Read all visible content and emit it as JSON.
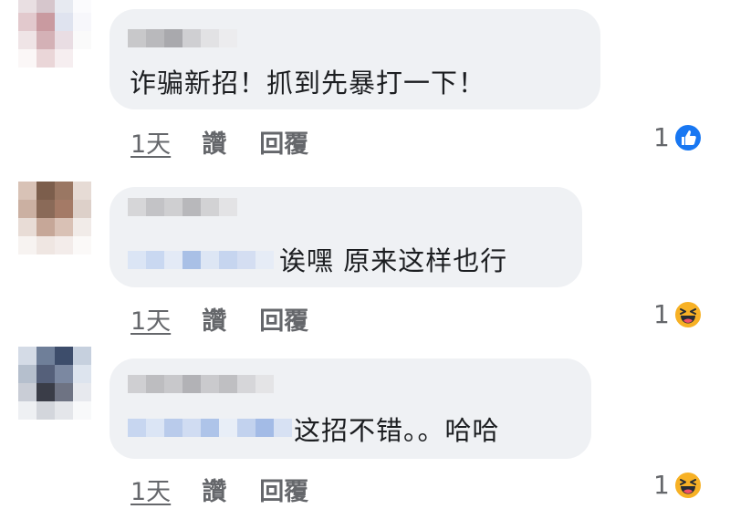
{
  "comments": [
    {
      "text": "诈骗新招！抓到先暴打一下！",
      "time": "1天",
      "like_label": "讚",
      "reply_label": "回覆",
      "reaction_count": "1",
      "reaction_icon": "like-icon"
    },
    {
      "text": "诶嘿 原来这样也行",
      "time": "1天",
      "like_label": "讚",
      "reply_label": "回覆",
      "reaction_count": "1",
      "reaction_icon": "haha-icon"
    },
    {
      "text": "这招不错。。哈哈",
      "time": "1天",
      "like_label": "讚",
      "reply_label": "回覆",
      "reaction_count": "1",
      "reaction_icon": "haha-icon"
    }
  ],
  "colors": {
    "bubble": "#eff1f4",
    "meta_text": "#65676b",
    "like_blue": "#1877f2",
    "haha_yellow": "#f7b125"
  }
}
